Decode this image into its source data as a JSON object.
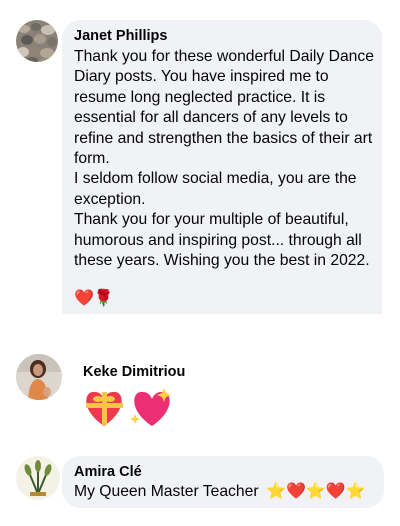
{
  "comments": [
    {
      "author": "Janet Phillips",
      "avatar_icon": "pebbles-avatar-icon",
      "text": "Thank you for these wonderful Daily Dance Diary posts. You have inspired me to resume long neglected practice. It is essential for all dancers of any levels to refine and strengthen the basics of their art form.\nI seldom follow social media, you are the exception.\nThank you for your multiple of beautiful, humorous and inspiring post... through all these years. Wishing you the best in 2022.",
      "emojis": "❤️🌹"
    },
    {
      "author": "Keke Dimitriou",
      "avatar_icon": "person-photo-avatar-icon",
      "emojis": "💝💖"
    },
    {
      "author": "Amira Clé",
      "avatar_icon": "wheat-emblem-avatar-icon",
      "text": "My Queen Master Teacher",
      "emojis": "⭐❤️⭐❤️⭐"
    }
  ],
  "colors": {
    "bubble": "#f0f2f5",
    "text": "#050505",
    "heart": "#e8112d",
    "star": "#f7b928"
  }
}
